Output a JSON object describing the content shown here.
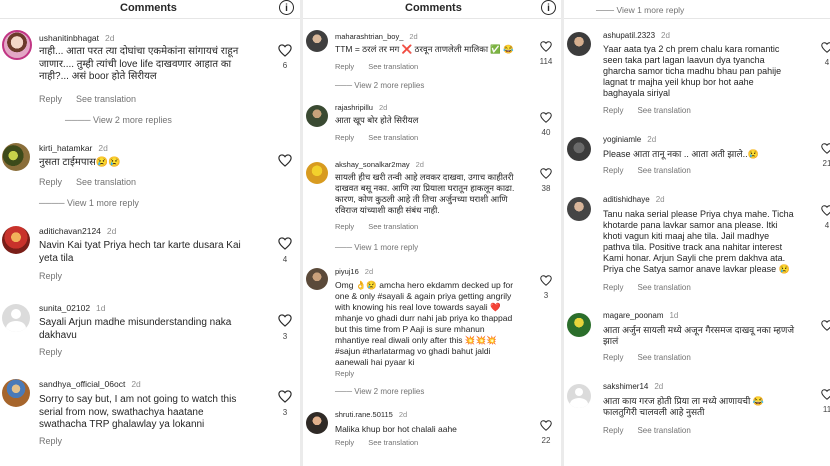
{
  "header": {
    "title": "Comments"
  },
  "actions": {
    "reply": "Reply",
    "see_translation": "See translation"
  },
  "panel1": {
    "comments": [
      {
        "user": "ushanitinbhagat",
        "time": "2d",
        "lines": [
          "नाही... आता परत त्या दोघांचा एकमेकांना सांगायचं राहून",
          "जाणार.... तुम्ही त्यांची love life दाखवणार आहात का",
          "नाही?... असं boor होते सिरीयल"
        ],
        "likes": "6",
        "view_more": "View 2 more replies"
      },
      {
        "user": "kirti_hatamkar",
        "time": "2d",
        "lines": [
          "नुसता टाईमपास😢😢"
        ],
        "likes": "",
        "view_more": "View 1 more reply"
      },
      {
        "user": "aditichavan2124",
        "time": "2d",
        "lines": [
          "Navin Kai  tyat Priya hech tar karte dusara Kai",
          "yeta tila"
        ],
        "likes": "4",
        "view_more": ""
      },
      {
        "user": "sunita_02102",
        "time": "1d",
        "lines": [
          "Sayali Arjun madhe misunderstanding naka",
          "dakhavu"
        ],
        "likes": "3",
        "view_more": ""
      },
      {
        "user": "sandhya_official_06oct",
        "time": "2d",
        "lines": [
          "Sorry to say but, I am not going to watch this",
          "serial from now, swathachya haatane",
          "swathacha TRP ghalawlay ya lokanni"
        ],
        "likes": "3",
        "view_more": ""
      }
    ]
  },
  "panel2": {
    "comments": [
      {
        "user": "maharashtrian_boy_",
        "time": "2d",
        "lines": [
          "TTM = ठरलं तर मग ❌ ठरवून ताणलेली मालिका ✅ 😂"
        ],
        "likes": "114",
        "view_more": "View 2 more replies"
      },
      {
        "user": "rajashripillu",
        "time": "2d",
        "lines": [
          "आता खूप बोर होते सिरीयल"
        ],
        "likes": "40",
        "view_more": ""
      },
      {
        "user": "akshay_sonalkar2may",
        "time": "2d",
        "lines": [
          "सायली हीच खरी तन्वी आहे लवकर दाखवा, उगाच काहीतरी",
          "दाखवत बसू नका. आणि त्या प्रियाला घरातून हाकलून काढा.",
          "कारण, कोण कुठली आहे ती तिचा अर्जुनच्या घराशी आणि",
          "रविराज यांच्याशी काही संबंध नाही."
        ],
        "likes": "38",
        "view_more": "View 1 more reply"
      },
      {
        "user": "piyuj16",
        "time": "2d",
        "lines": [
          "Omg 👌😢 amcha hero ekdamm decked up for",
          "one & only #sayali & again priya getting angrily",
          "with knowing his real love towards sayali ❤️",
          "mhanje vo ghadi durr nahi jab priya ko thappad",
          "but this time from P Aaji is sure mhanun",
          "mhantiye real diwali only after this 💥💥💥",
          "#sajun #tharlatarmag vo ghadi bahut jaldi",
          "aanewali hai pyaar ki"
        ],
        "likes": "3",
        "view_more": "View 2 more replies"
      },
      {
        "user": "shruti.rane.50115",
        "time": "2d",
        "lines": [
          "Malika khup bor hot chalali aahe"
        ],
        "likes": "22",
        "view_more": ""
      }
    ]
  },
  "panel3": {
    "top_view_more": "View 1 more reply",
    "comments": [
      {
        "user": "ashupatil.2323",
        "time": "2d",
        "lines": [
          "Yaar aata tya 2 ch prem chalu kara romantic",
          "seen taka part lagan laavun dya tyancha",
          "gharcha samor ticha madhu bhau pan pahije",
          "lagnat tr majha yeil khup bor hot aahe",
          "baghayala siriyal"
        ],
        "likes": "4"
      },
      {
        "user": "yoginiamle",
        "time": "2d",
        "lines": [
          "Please आता तानू नका .. आता अती झाले..😢"
        ],
        "likes": "21"
      },
      {
        "user": "aditishidhaye",
        "time": "2d",
        "lines": [
          "Tanu naka serial please Priya chya mahe. Ticha",
          "khotarde pana lavkar samor ana please. Itki",
          "khoti vagun kiti maaj ahe tila. Jail madhye",
          "pathva tila. Positive track ana nahitar interest",
          "Kami honar. Arjun Sayli che prem dakhva ata.",
          "Priya che Satya samor anave lavkar please 😢"
        ],
        "likes": "4"
      },
      {
        "user": "magare_poonam",
        "time": "1d",
        "lines": [
          "आता अर्जुन सायली मध्ये अजून गैरसमज दाखवू नका म्हणजे",
          "झालं"
        ],
        "likes": ""
      },
      {
        "user": "sakshimer14",
        "time": "2d",
        "lines": [
          "आता काय गरज होती प्रिया ला मध्ये आणायची 😂",
          "फालतुगिरी चालवली आहे नुसती"
        ],
        "likes": "11"
      }
    ]
  }
}
